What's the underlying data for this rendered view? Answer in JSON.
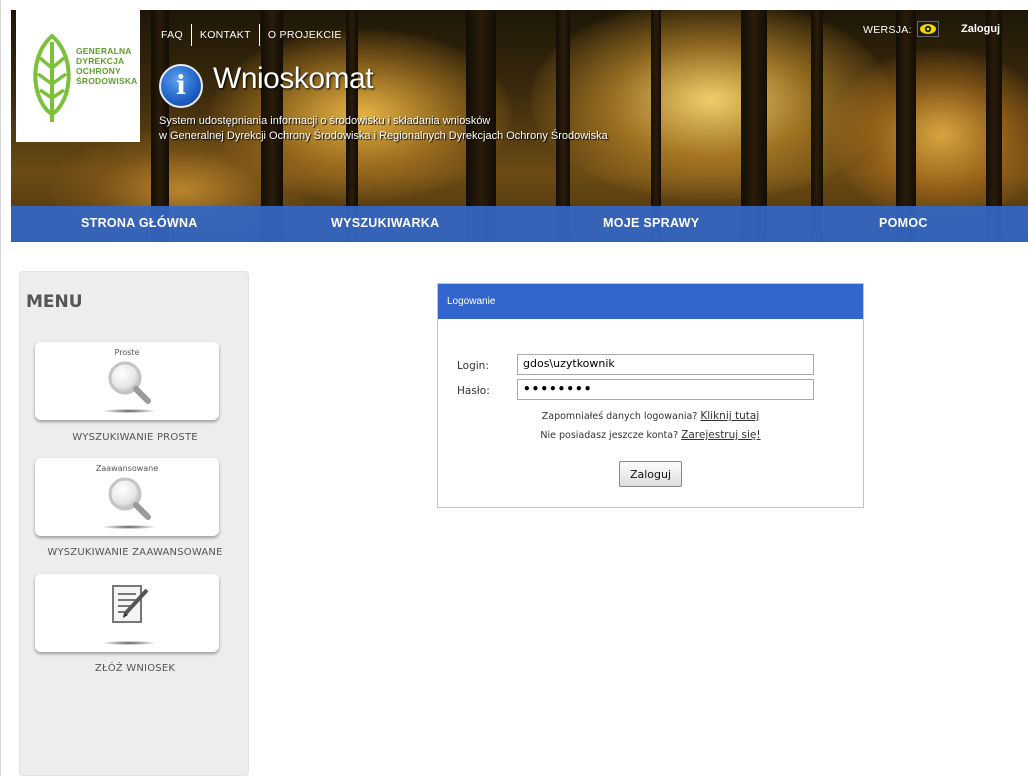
{
  "logo": {
    "lines": [
      "GENERALNA",
      "DYREKCJA",
      "OCHRONY",
      "ŚRODOWISKA"
    ]
  },
  "top_links": {
    "faq": "FAQ",
    "contact": "KONTAKT",
    "about": "O PROJEKCIE"
  },
  "version_label": "WERSJA:",
  "login_link": "Zaloguj",
  "app": {
    "title": "Wnioskomat",
    "subtitle_line1": "System udostępniania informacji o środowisku i składania wniosków",
    "subtitle_line2": "w Generalnej Dyrekcji Ochrony Środowiska i Regionalnych Dyrekcjach Ochrony Środowiska"
  },
  "nav": {
    "home": "STRONA GŁÓWNA",
    "search": "WYSZUKIWARKA",
    "cases": "MOJE SPRAWY",
    "help": "POMOC"
  },
  "sidebar": {
    "title": "MENU",
    "items": [
      {
        "card_label": "Proste",
        "caption": "WYSZUKIWANIE PROSTE",
        "icon": "magnifier-icon"
      },
      {
        "card_label": "Zaawansowane",
        "caption": "WYSZUKIWANIE ZAAWANSOWANE",
        "icon": "magnifier-icon"
      },
      {
        "card_label": "",
        "caption": "ZŁÓŻ WNIOSEK",
        "icon": "document-pen-icon"
      }
    ]
  },
  "login_form": {
    "header": "Logowanie",
    "login_label": "Login:",
    "login_value": "gdos\\uzytkownik",
    "password_label": "Hasło:",
    "password_value": "••••••••",
    "forgot_text": "Zapomniałeś danych logowania?",
    "forgot_link": "Kliknij tutaj",
    "register_text": "Nie posiadasz jeszcze konta?",
    "register_link": "Zarejestruj się!",
    "submit": "Zaloguj"
  },
  "colors": {
    "nav_blue": "#3366cc",
    "panel_header": "#3366cc",
    "logo_green": "#5e9e2e",
    "sidebar_bg": "#ededed"
  }
}
